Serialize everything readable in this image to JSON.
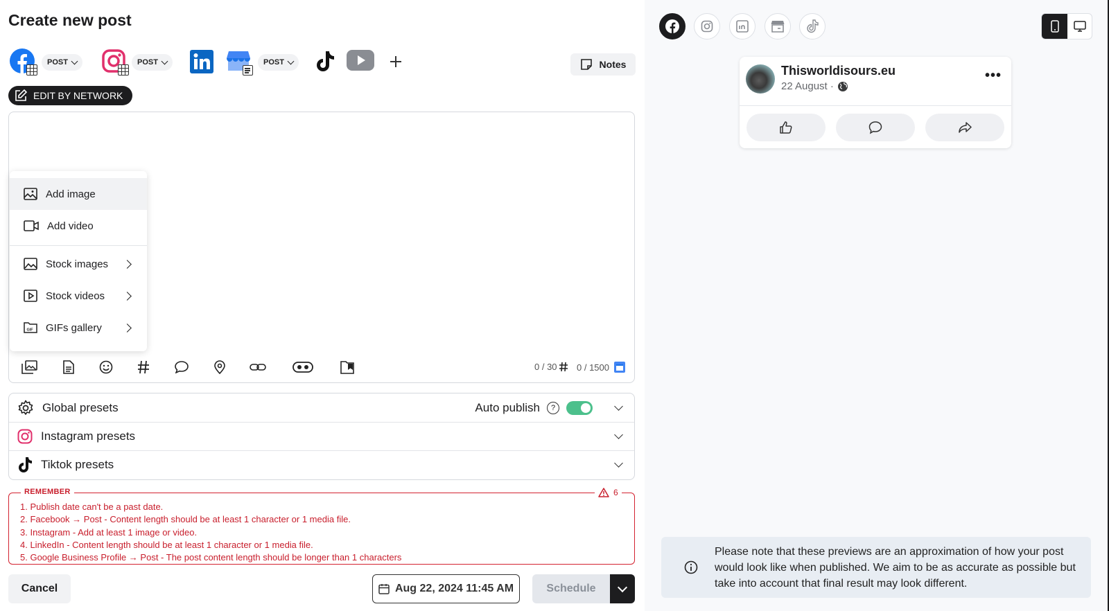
{
  "page": {
    "title": "Create new post"
  },
  "networks": {
    "facebook_format": "POST",
    "instagram_format": "POST",
    "google_business_format": "POST"
  },
  "notes_label": "Notes",
  "edit_by_network_label": "EDIT BY NETWORK",
  "media_menu": {
    "items": [
      {
        "label": "Add image",
        "icon": "image-icon"
      },
      {
        "label": "Add video",
        "icon": "video-icon"
      },
      {
        "label": "Stock images",
        "icon": "stock-image-icon"
      },
      {
        "label": "Stock videos",
        "icon": "stock-video-icon"
      },
      {
        "label": "GIFs gallery",
        "icon": "gif-icon"
      }
    ]
  },
  "counters": {
    "hashtags": "0 / 30",
    "characters": "0 / 1500"
  },
  "presets": {
    "global": "Global presets",
    "auto_publish": "Auto publish",
    "auto_publish_on": true,
    "instagram": "Instagram presets",
    "tiktok": "Tiktok presets"
  },
  "remember": {
    "label": "REMEMBER",
    "count": "6",
    "items": [
      "1. Publish date can't be a past date.",
      "2. Facebook → Post - Content length should be at least 1 character or 1 media file.",
      "3. Instagram - Add at least 1 image or video.",
      "4. LinkedIn - Content length should be at least 1 character or 1 media file.",
      "5. Google Business Profile → Post - The post content length should be longer than 1 characters"
    ]
  },
  "footer": {
    "cancel": "Cancel",
    "date": "Aug 22, 2024 11:45 AM",
    "schedule": "Schedule"
  },
  "preview": {
    "account_name": "Thisworldisours.eu",
    "post_date": "22 August ·",
    "info": "Please note that these previews are an approximation of how your post would look like when published. We aim to be as accurate as possible but take into account that final result may look different."
  },
  "colors": {
    "facebook": "#1877f2",
    "instagram": "#e1306c",
    "linkedin": "#0a66c2",
    "google_business": "#4285f4",
    "youtube": "#8a8d93",
    "toggle_on": "#4cc08c",
    "warning_red": "#c81e2c"
  }
}
